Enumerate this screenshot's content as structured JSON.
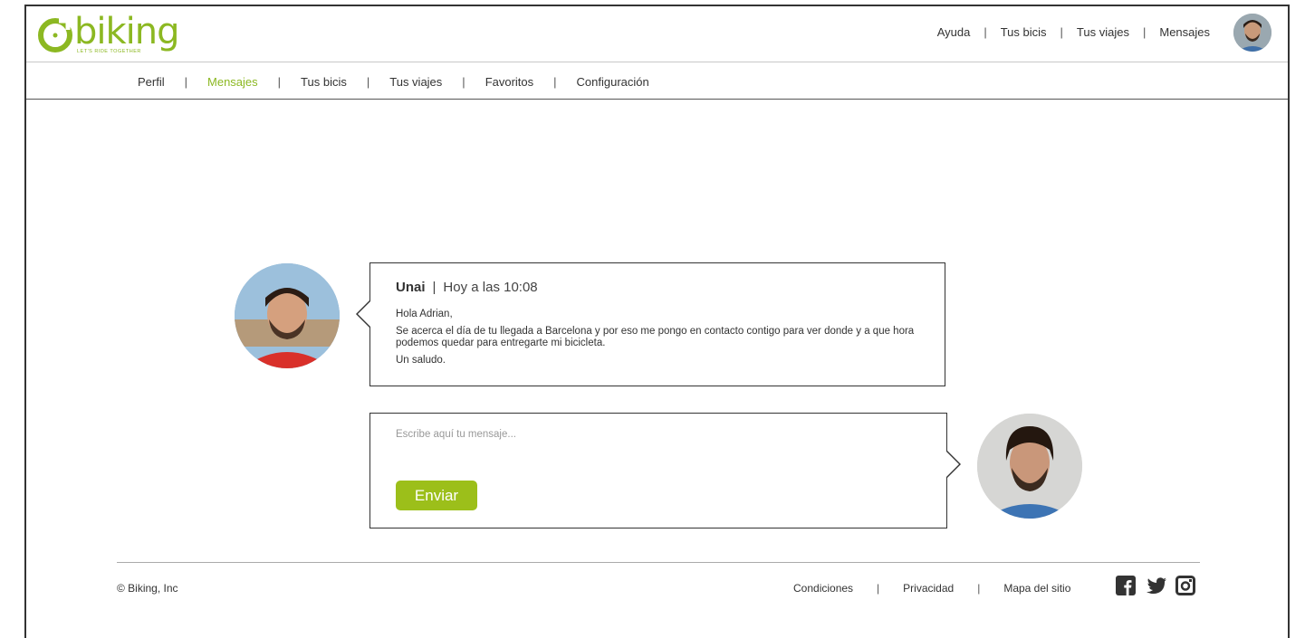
{
  "brand": {
    "name": "biking",
    "tagline": "LET'S RIDE TOGETHER",
    "color": "#8cb822"
  },
  "topnav": {
    "items": [
      "Ayuda",
      "Tus bicis",
      "Tus viajes",
      "Mensajes"
    ]
  },
  "subnav": {
    "items": [
      "Perfil",
      "Mensajes",
      "Tus bicis",
      "Tus viajes",
      "Favoritos",
      "Configuración"
    ],
    "active": "Mensajes"
  },
  "message": {
    "sender": "Unai",
    "time": "Hoy a las 10:08",
    "greeting": "Hola Adrian,",
    "body": "Se acerca el día de tu llegada a Barcelona y por eso me pongo en contacto contigo para ver donde y a que hora podemos quedar para entregarte mi bicicleta.",
    "closing": "Un saludo."
  },
  "reply": {
    "placeholder": "Escribe aquí tu mensaje...",
    "send_label": "Enviar",
    "button_color": "#9cbf1a"
  },
  "footer": {
    "copyright": "© Biking, Inc",
    "links": [
      "Condiciones",
      "Privacidad",
      "Mapa del sitio"
    ],
    "social_icons": [
      "facebook-icon",
      "twitter-icon",
      "instagram-icon"
    ]
  }
}
